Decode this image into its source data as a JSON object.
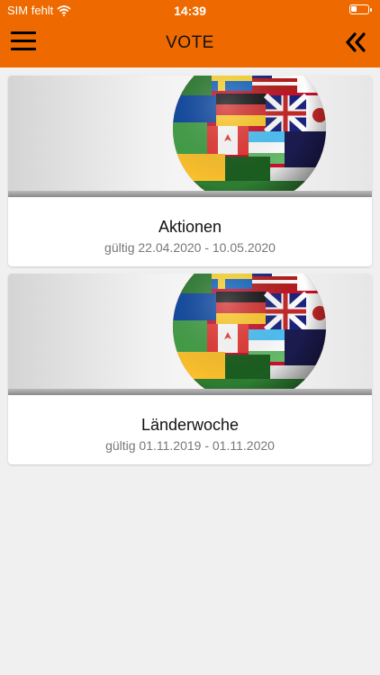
{
  "status": {
    "carrier": "SIM fehlt",
    "time": "14:39"
  },
  "nav": {
    "title": "VOTE",
    "menu_icon": "hamburger-menu-icon",
    "back_icon": "double-chevron-left-icon"
  },
  "colors": {
    "accent": "#ee6a00",
    "background": "#f0f0f0"
  },
  "cards": [
    {
      "title": "Aktionen",
      "validity": "gültig 22.04.2020 - 10.05.2020"
    },
    {
      "title": "Länderwoche",
      "validity": "gültig 01.11.2019 - 01.11.2020"
    }
  ]
}
